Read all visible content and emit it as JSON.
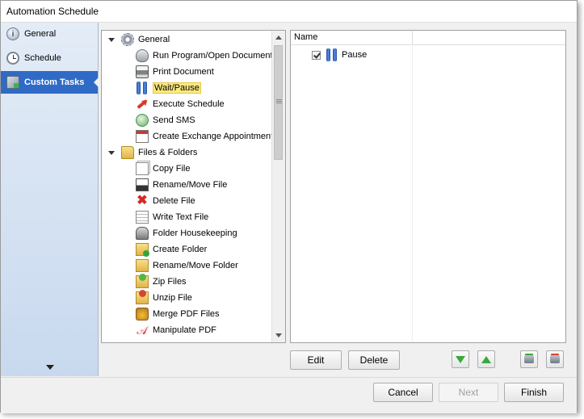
{
  "window": {
    "title": "Automation Schedule"
  },
  "sidebar": {
    "items": [
      {
        "label": "General",
        "icon": "info-icon"
      },
      {
        "label": "Schedule",
        "icon": "clock-icon"
      },
      {
        "label": "Custom Tasks",
        "icon": "tasks-icon",
        "active": true
      }
    ]
  },
  "tree": {
    "groups": [
      {
        "label": "General",
        "icon": "gear-icon",
        "items": [
          {
            "label": "Run Program/Open Document",
            "icon": "run-program-icon"
          },
          {
            "label": "Print Document",
            "icon": "printer-icon"
          },
          {
            "label": "Wait/Pause",
            "icon": "pause-icon",
            "selected": true
          },
          {
            "label": "Execute Schedule",
            "icon": "execute-schedule-icon"
          },
          {
            "label": "Send SMS",
            "icon": "sms-icon"
          },
          {
            "label": "Create Exchange Appointment",
            "icon": "calendar-icon"
          }
        ]
      },
      {
        "label": "Files & Folders",
        "icon": "folder-icon",
        "items": [
          {
            "label": "Copy File",
            "icon": "copy-file-icon"
          },
          {
            "label": "Rename/Move File",
            "icon": "rename-file-icon"
          },
          {
            "label": "Delete File",
            "icon": "delete-icon"
          },
          {
            "label": "Write Text File",
            "icon": "write-text-icon"
          },
          {
            "label": "Folder Housekeeping",
            "icon": "housekeeping-icon"
          },
          {
            "label": "Create Folder",
            "icon": "create-folder-icon"
          },
          {
            "label": "Rename/Move Folder",
            "icon": "rename-folder-icon"
          },
          {
            "label": "Zip Files",
            "icon": "zip-icon"
          },
          {
            "label": "Unzip File",
            "icon": "unzip-icon"
          },
          {
            "label": "Merge PDF Files",
            "icon": "merge-pdf-icon"
          },
          {
            "label": "Manipulate PDF",
            "icon": "pdf-icon"
          }
        ]
      }
    ]
  },
  "grid": {
    "header": {
      "name": "Name"
    },
    "rows": [
      {
        "label": "Pause",
        "checked": true,
        "icon": "pause-icon"
      }
    ]
  },
  "actions": {
    "edit": "Edit",
    "delete": "Delete"
  },
  "footer": {
    "cancel": "Cancel",
    "next": "Next",
    "finish": "Finish"
  },
  "colors": {
    "accent": "#2f6bc6",
    "selection": "#fbe97f"
  }
}
